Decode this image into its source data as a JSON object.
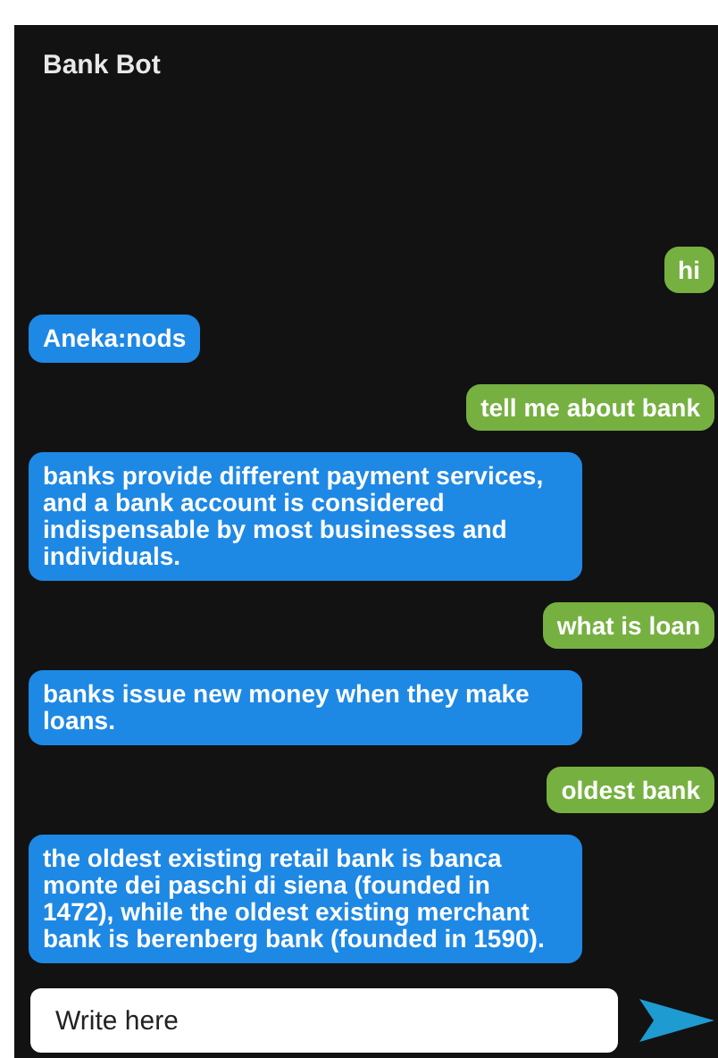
{
  "header": {
    "title": "Bank Bot"
  },
  "messages": [
    {
      "kind": "user",
      "text": "hi"
    },
    {
      "kind": "bot",
      "text": "Aneka:nods"
    },
    {
      "kind": "user",
      "text": "tell me about bank"
    },
    {
      "kind": "bot",
      "text": "banks provide different payment services, and a bank account is considered indispensable by most businesses and individuals."
    },
    {
      "kind": "user",
      "text": "what is loan"
    },
    {
      "kind": "bot",
      "text": "banks issue new money when they make loans."
    },
    {
      "kind": "user",
      "text": "oldest bank"
    },
    {
      "kind": "bot",
      "text": "the oldest existing retail bank is banca monte dei paschi di siena (founded in 1472), while the oldest existing merchant bank is berenberg bank (founded in 1590)."
    }
  ],
  "composer": {
    "placeholder": "Write here"
  }
}
